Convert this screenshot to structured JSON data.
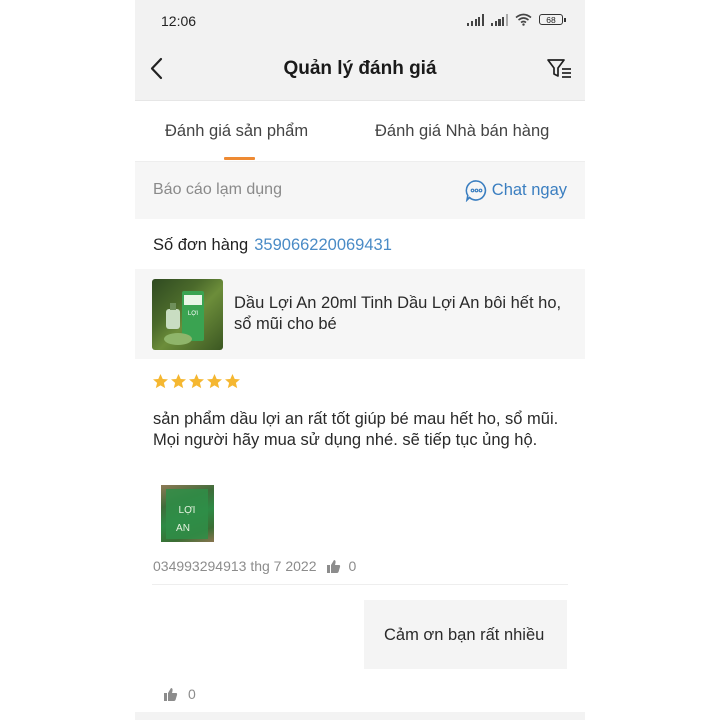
{
  "status_bar": {
    "time": "12:06",
    "battery": "68"
  },
  "header": {
    "title": "Quản lý đánh giá"
  },
  "tabs": [
    {
      "label": "Đánh giá sản phẩm",
      "active": true
    },
    {
      "label": "Đánh giá Nhà bán hàng",
      "active": false
    }
  ],
  "report": {
    "label": "Báo cáo lạm dụng",
    "chat_label": "Chat ngay"
  },
  "order": {
    "label": "Số đơn hàng",
    "number": "359066220069431"
  },
  "product": {
    "name": "Dầu Lợi An 20ml Tinh Dầu Lợi An bôi hết ho, sổ mũi cho bé",
    "thumb_text": "LỢI"
  },
  "review": {
    "rating": 5,
    "text": "sản phẩm dầu lợi an rất tốt giúp bé mau hết ho, sổ mũi. Mọi người hãy mua sử dụng nhé. sẽ tiếp tục ủng hộ.",
    "photo_text_1": "LỢI",
    "photo_text_2": "AN",
    "author_date": "034993294913 thg 7 2022",
    "likes": "0"
  },
  "reply": {
    "text": "Cảm ơn bạn rất nhiều",
    "likes": "0"
  },
  "colors": {
    "accent": "#ee8a33",
    "link": "#4a8bc6",
    "star": "#f5b731"
  }
}
